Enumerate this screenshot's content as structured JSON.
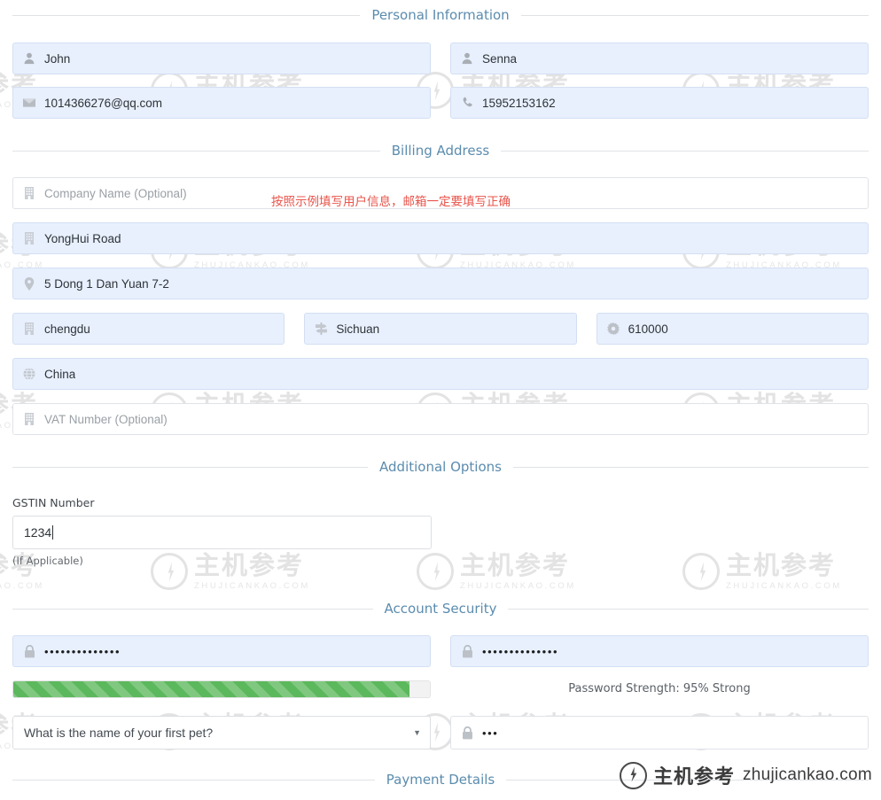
{
  "sections": {
    "personal": "Personal Information",
    "billing": "Billing Address",
    "additional": "Additional Options",
    "security": "Account Security",
    "payment": "Payment Details"
  },
  "personal": {
    "first_name": {
      "icon": "user-icon",
      "value": "John"
    },
    "last_name": {
      "icon": "user-icon",
      "value": "Senna"
    },
    "email": {
      "icon": "envelope-icon",
      "value": "1014366276@qq.com"
    },
    "phone": {
      "icon": "phone-icon",
      "value": "15952153162"
    }
  },
  "billing": {
    "company": {
      "icon": "building-icon",
      "placeholder": "Company Name (Optional)",
      "value": ""
    },
    "address1": {
      "icon": "building-icon",
      "value": "YongHui Road"
    },
    "address2": {
      "icon": "map-pin-icon",
      "value": "5 Dong 1 Dan Yuan 7-2"
    },
    "city": {
      "icon": "building-icon",
      "value": "chengdu"
    },
    "state": {
      "icon": "map-signs-icon",
      "value": "Sichuan"
    },
    "postcode": {
      "icon": "gear-icon",
      "value": "610000"
    },
    "country": {
      "icon": "globe-icon",
      "value": "China"
    },
    "vat": {
      "icon": "building-icon",
      "placeholder": "VAT Number (Optional)",
      "value": ""
    }
  },
  "annotation": {
    "text": "按照示例填写用户信息，邮箱一定要填写正确",
    "color": "#e8544b"
  },
  "additional": {
    "gstin_label": "GSTIN Number",
    "gstin_value": "1234",
    "gstin_hint": "(If Applicable)"
  },
  "security": {
    "password": {
      "icon": "lock-icon",
      "value": "••••••••••••••"
    },
    "confirm_password": {
      "icon": "lock-icon",
      "value": "••••••••••••••"
    },
    "strength_text": "Password Strength: 95% Strong",
    "strength_percent": 95,
    "strength_color": "#5cb85c",
    "question_selected": "What is the name of your first pet?",
    "question_options": [
      "What is the name of your first pet?"
    ],
    "answer": {
      "icon": "lock-icon",
      "value": "•••"
    }
  },
  "watermark": {
    "cn": "主机参考",
    "en": "ZHUJICANKAO.COM"
  },
  "footer": {
    "cn": "主机参考",
    "url": "zhujicankao.com"
  }
}
